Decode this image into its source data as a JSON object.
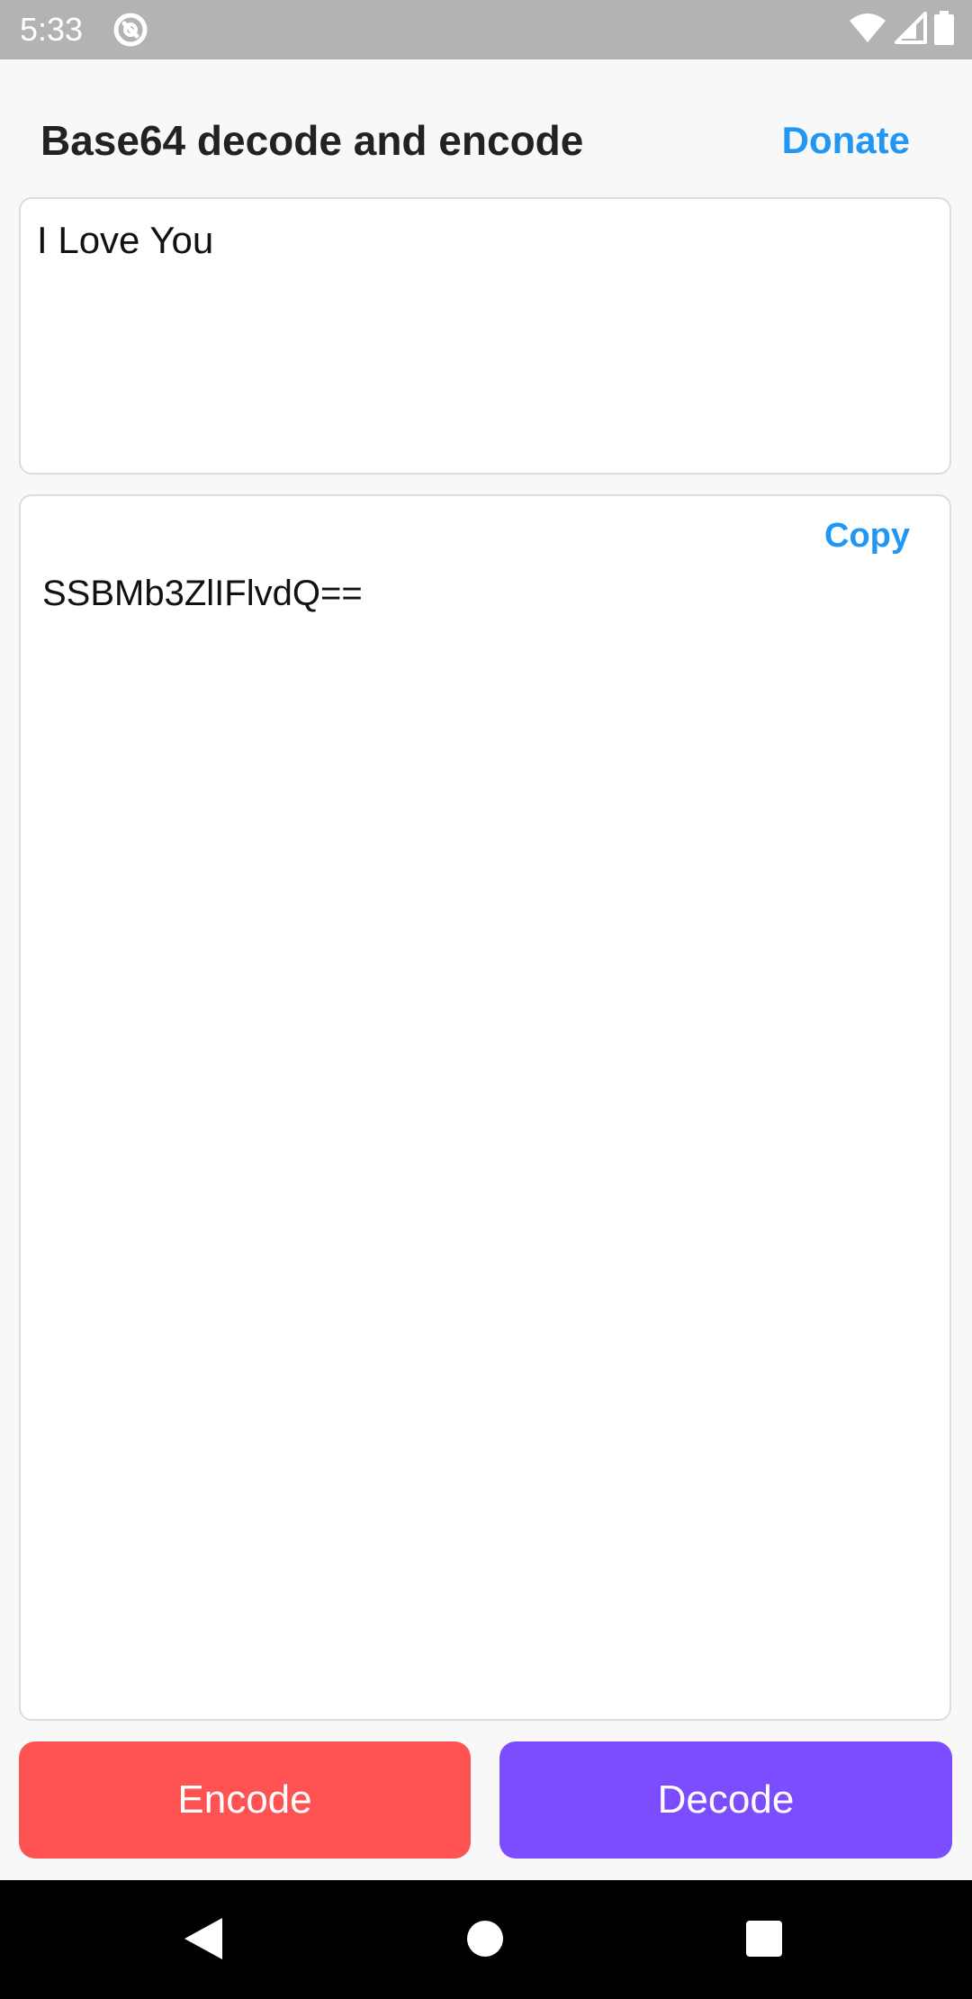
{
  "status_bar": {
    "time": "5:33",
    "icons": [
      "notification-icon",
      "wifi-icon",
      "signal-icon",
      "battery-icon"
    ]
  },
  "header": {
    "title": "Base64 decode and encode",
    "donate_label": "Donate"
  },
  "input": {
    "value": "I Love You"
  },
  "output": {
    "copy_label": "Copy",
    "value": "SSBMb3ZlIFlvdQ=="
  },
  "actions": {
    "encode_label": "Encode",
    "decode_label": "Decode"
  },
  "colors": {
    "accent_blue": "#2196f3",
    "encode_red": "#ff5252",
    "decode_purple": "#7c4dff",
    "status_bar": "#b3b3b3"
  }
}
